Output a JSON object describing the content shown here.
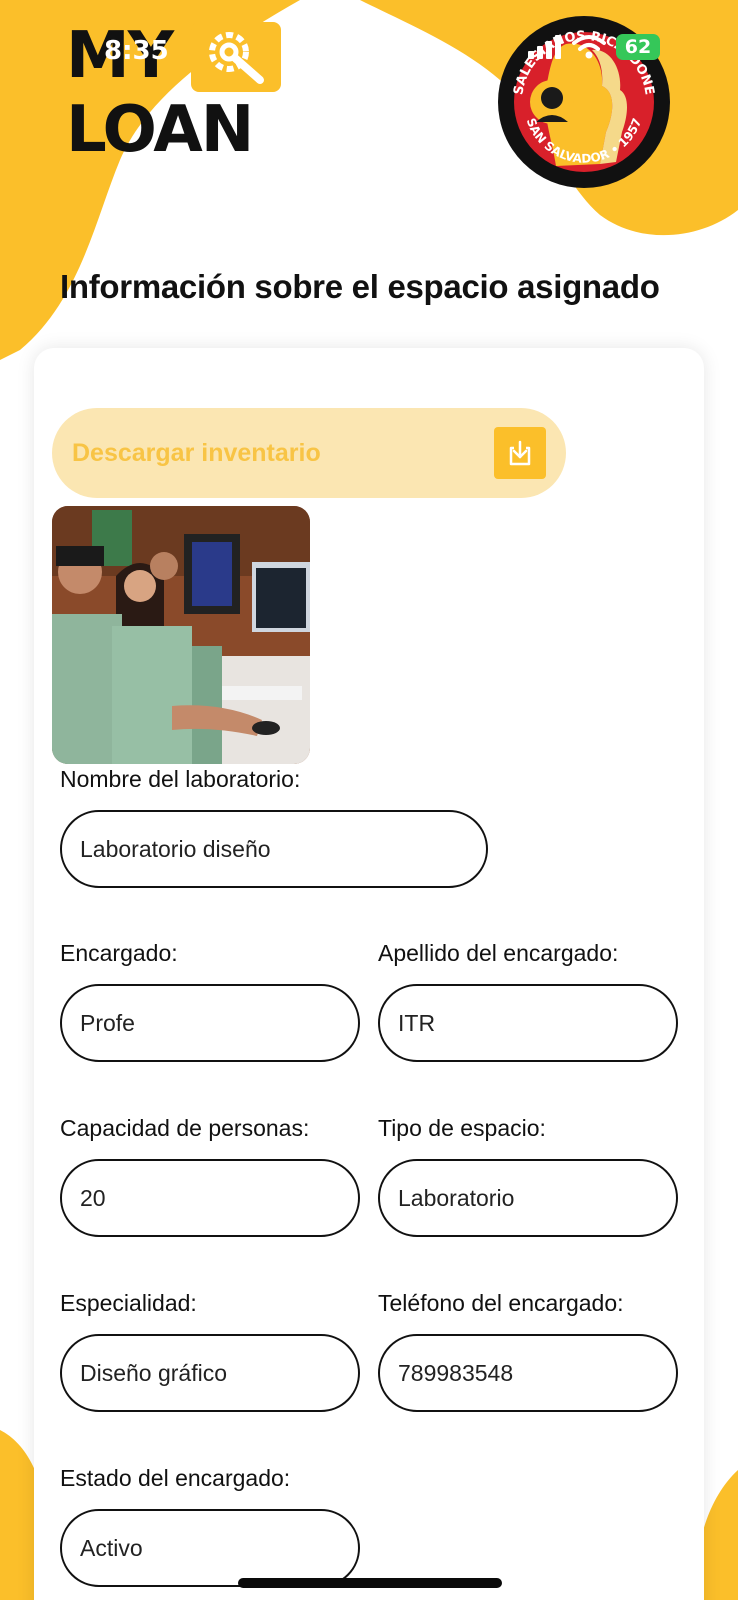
{
  "status_bar": {
    "time": "8:35",
    "battery": "62"
  },
  "logo": {
    "line1": "MY",
    "line2": "LOAN"
  },
  "seal": {
    "top_text": "SALESIANOS RICALDONE",
    "bottom_text": "SAN SALVADOR • 1957"
  },
  "title": "Información sobre el espacio asignado",
  "download": {
    "label": "Descargar inventario"
  },
  "fields": {
    "lab_name": {
      "label": "Nombre del laboratorio:",
      "value": "Laboratorio diseño"
    },
    "manager": {
      "label": "Encargado:",
      "value": "Profe"
    },
    "manager_lastname": {
      "label": "Apellido del encargado:",
      "value": "ITR"
    },
    "capacity": {
      "label": "Capacidad de personas:",
      "value": "20"
    },
    "space_type": {
      "label": "Tipo de espacio:",
      "value": "Laboratorio"
    },
    "specialty": {
      "label": "Especialidad:",
      "value": "Diseño gráfico"
    },
    "manager_phone": {
      "label": "Teléfono del encargado:",
      "value": "789983548"
    },
    "manager_status": {
      "label": "Estado del encargado:",
      "value": "Activo"
    }
  },
  "colors": {
    "accent": "#fbbf2a",
    "accent_light": "#fbe6b2",
    "seal_red": "#d8202a"
  },
  "icons": {
    "download": "download-icon",
    "tool": "wrench-gear-icon",
    "signal": "signal-icon",
    "wifi": "wifi-icon"
  }
}
